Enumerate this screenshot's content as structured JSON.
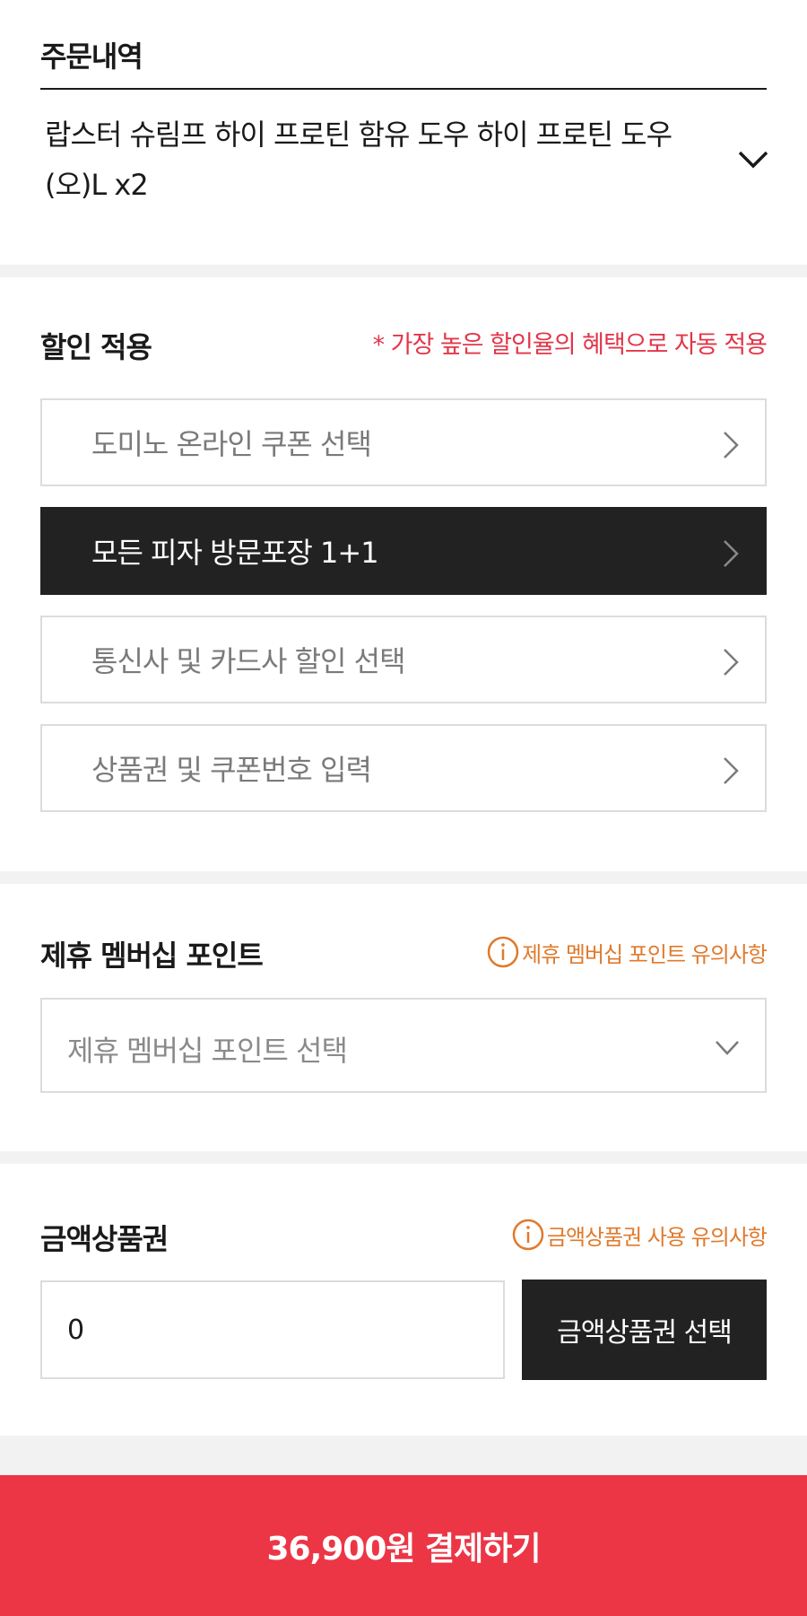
{
  "order": {
    "title": "주문내역",
    "item_text": "랍스터 슈림프 하이 프로틴 함유 도우 하이 프로틴 도우(오)L x2",
    "expand_icon": "chevron-down-icon"
  },
  "discount": {
    "title": "할인 적용",
    "note": "* 가장 높은 할인율의 혜택으로 자동 적용",
    "options": [
      {
        "label": "도미노 온라인 쿠폰 선택",
        "selected": false
      },
      {
        "label": "모든 피자 방문포장 1+1",
        "selected": true
      },
      {
        "label": "통신사 및 카드사 할인 선택",
        "selected": false
      },
      {
        "label": "상품권 및 쿠폰번호 입력",
        "selected": false
      }
    ]
  },
  "membership": {
    "title": "제휴 멤버십 포인트",
    "notice_link": "제휴 멤버십 포인트 유의사항",
    "select_placeholder": "제휴 멤버십 포인트 선택"
  },
  "gift_card": {
    "title": "금액상품권",
    "notice_link": "금액상품권 사용 유의사항",
    "amount_value": "0",
    "select_button": "금액상품권 선택"
  },
  "payment": {
    "button_label": "36,900원 결제하기"
  },
  "colors": {
    "accent_red": "#ec3646",
    "note_red": "#e2364a",
    "notice_orange": "#e07a2c",
    "dark_button": "#222222"
  }
}
